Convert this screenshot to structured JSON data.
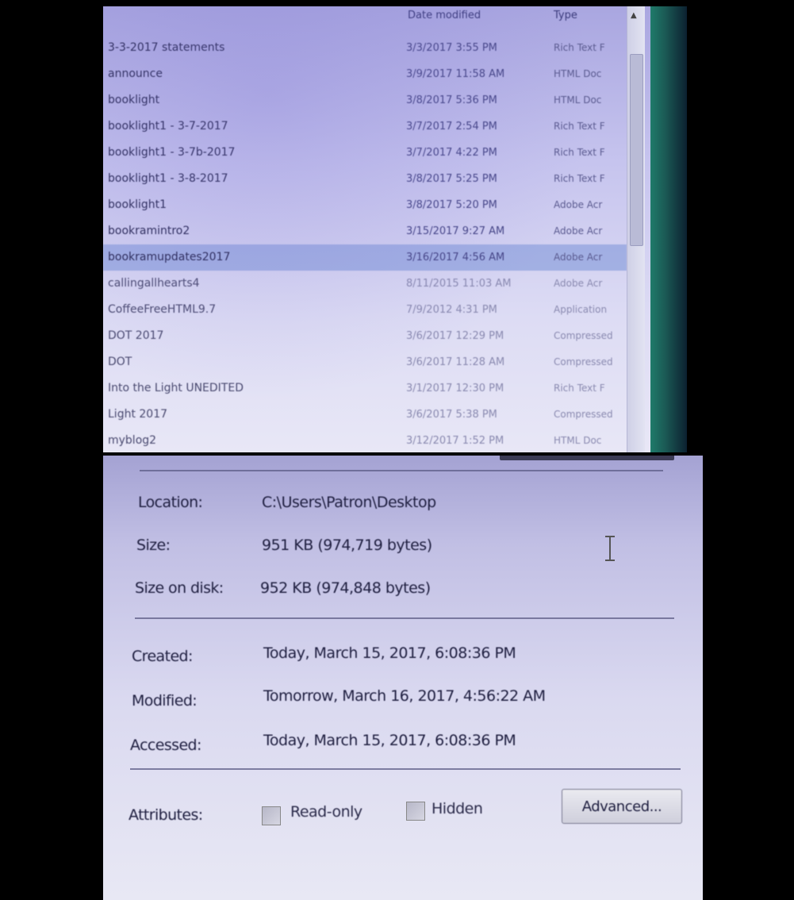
{
  "file_list": {
    "columns": {
      "date_modified": "Date modified",
      "type": "Type"
    },
    "rows": [
      {
        "name": "3-3-2017 statements",
        "date": "3/3/2017 3:55 PM",
        "type": "Rich Text F"
      },
      {
        "name": "announce",
        "date": "3/9/2017 11:58 AM",
        "type": "HTML Doc"
      },
      {
        "name": "booklight",
        "date": "3/8/2017 5:36 PM",
        "type": "HTML Doc"
      },
      {
        "name": "booklight1 - 3-7-2017",
        "date": "3/7/2017 2:54 PM",
        "type": "Rich Text F"
      },
      {
        "name": "booklight1 - 3-7b-2017",
        "date": "3/7/2017 4:22 PM",
        "type": "Rich Text F"
      },
      {
        "name": "booklight1 - 3-8-2017",
        "date": "3/8/2017 5:25 PM",
        "type": "Rich Text F"
      },
      {
        "name": "booklight1",
        "date": "3/8/2017 5:20 PM",
        "type": "Adobe Acr"
      },
      {
        "name": "bookramintro2",
        "date": "3/15/2017 9:27 AM",
        "type": "Adobe Acr"
      },
      {
        "name": "bookramupdates2017",
        "date": "3/16/2017 4:56 AM",
        "type": "Adobe Acr",
        "selected": true
      },
      {
        "name": "callingallhearts4",
        "date": "8/11/2015 11:03 AM",
        "type": "Adobe Acr"
      },
      {
        "name": "CoffeeFreeHTML9.7",
        "date": "7/9/2012 4:31 PM",
        "type": "Application"
      },
      {
        "name": "DOT 2017",
        "date": "3/6/2017 12:29 PM",
        "type": "Compressed"
      },
      {
        "name": "DOT",
        "date": "3/6/2017 11:28 AM",
        "type": "Compressed"
      },
      {
        "name": "Into the Light UNEDITED",
        "date": "3/1/2017 12:30 PM",
        "type": "Rich Text F"
      },
      {
        "name": "Light 2017",
        "date": "3/6/2017 5:38 PM",
        "type": "Compressed"
      },
      {
        "name": "myblog2",
        "date": "3/12/2017 1:52 PM",
        "type": "HTML Doc"
      }
    ]
  },
  "properties": {
    "location": {
      "label": "Location:",
      "value": "C:\\Users\\Patron\\Desktop"
    },
    "size": {
      "label": "Size:",
      "value": "951 KB (974,719 bytes)"
    },
    "size_on_disk": {
      "label": "Size on disk:",
      "value": "952 KB (974,848 bytes)"
    },
    "created": {
      "label": "Created:",
      "value": "Today, March 15, 2017, 6:08:36 PM"
    },
    "modified": {
      "label": "Modified:",
      "value": "Tomorrow, March 16, 2017, 4:56:22 AM"
    },
    "accessed": {
      "label": "Accessed:",
      "value": "Today, March 15, 2017, 6:08:36 PM"
    },
    "attributes": {
      "label": "Attributes:",
      "read_only_label": "Read-only",
      "read_only_checked": false,
      "hidden_label": "Hidden",
      "hidden_checked": false,
      "advanced_button": "Advanced..."
    }
  },
  "icons": {
    "cursor": "text-cursor-icon",
    "scroll": "scroll-up-arrow-icon"
  },
  "colors": {
    "selection": "#7891d7",
    "accent_edge": "#1f7b6a"
  }
}
